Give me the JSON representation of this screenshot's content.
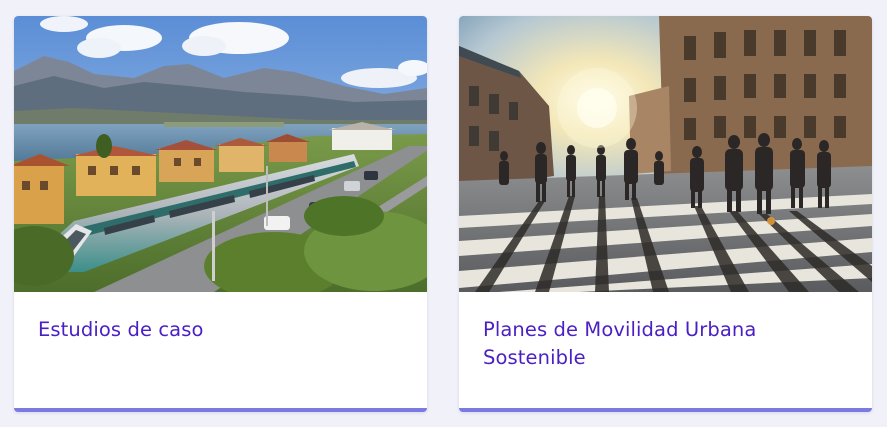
{
  "cards": [
    {
      "title": "Estudios de caso",
      "image": "lakeside-train-photo"
    },
    {
      "title": "Planes de Movilidad Urbana Sostenible",
      "image": "pedestrian-crossing-photo"
    }
  ],
  "colors": {
    "background": "#f1f1fa",
    "card": "#ffffff",
    "title": "#4a1fc3",
    "accent_border": "#7b79e2"
  }
}
